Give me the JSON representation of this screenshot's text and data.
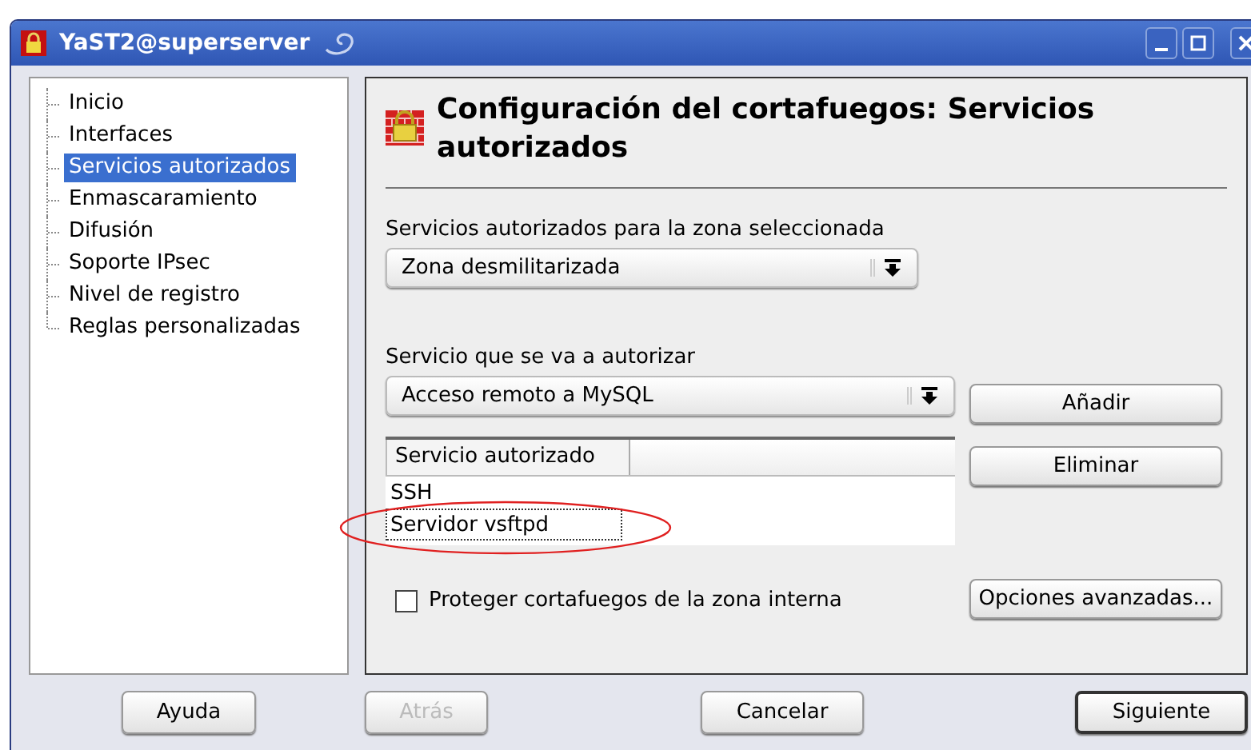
{
  "window": {
    "title": "YaST2@superserver"
  },
  "tree": {
    "items": [
      {
        "label": "Inicio",
        "selected": false
      },
      {
        "label": "Interfaces",
        "selected": false
      },
      {
        "label": "Servicios autorizados",
        "selected": true
      },
      {
        "label": "Enmascaramiento",
        "selected": false
      },
      {
        "label": "Difusión",
        "selected": false
      },
      {
        "label": "Soporte IPsec",
        "selected": false
      },
      {
        "label": "Nivel de registro",
        "selected": false
      },
      {
        "label": "Reglas personalizadas",
        "selected": false
      }
    ]
  },
  "heading": "Configuración del cortafuegos: Servicios autorizados",
  "zone": {
    "label": "Servicios autorizados para la zona seleccionada",
    "value": "Zona desmilitarizada"
  },
  "service": {
    "label": "Servicio que se va a autorizar",
    "value": "Acceso remoto a MySQL"
  },
  "table": {
    "columns": [
      "Servicio autorizado"
    ],
    "rows": [
      {
        "cells": [
          "SSH"
        ],
        "focused": false,
        "circled": false
      },
      {
        "cells": [
          "Servidor vsftpd"
        ],
        "focused": true,
        "circled": true
      }
    ]
  },
  "side_buttons": [
    "Añadir",
    "Eliminar",
    "Opciones avanzadas..."
  ],
  "protect_checkbox": {
    "label": "Proteger cortafuegos de la zona interna",
    "checked": false
  },
  "footer_buttons": [
    {
      "label": "Ayuda",
      "disabled": false,
      "default": false
    },
    {
      "label": "Atrás",
      "disabled": true,
      "default": false
    },
    {
      "label": "Cancelar",
      "disabled": false,
      "default": false
    },
    {
      "label": "Siguiente",
      "disabled": false,
      "default": true
    }
  ]
}
